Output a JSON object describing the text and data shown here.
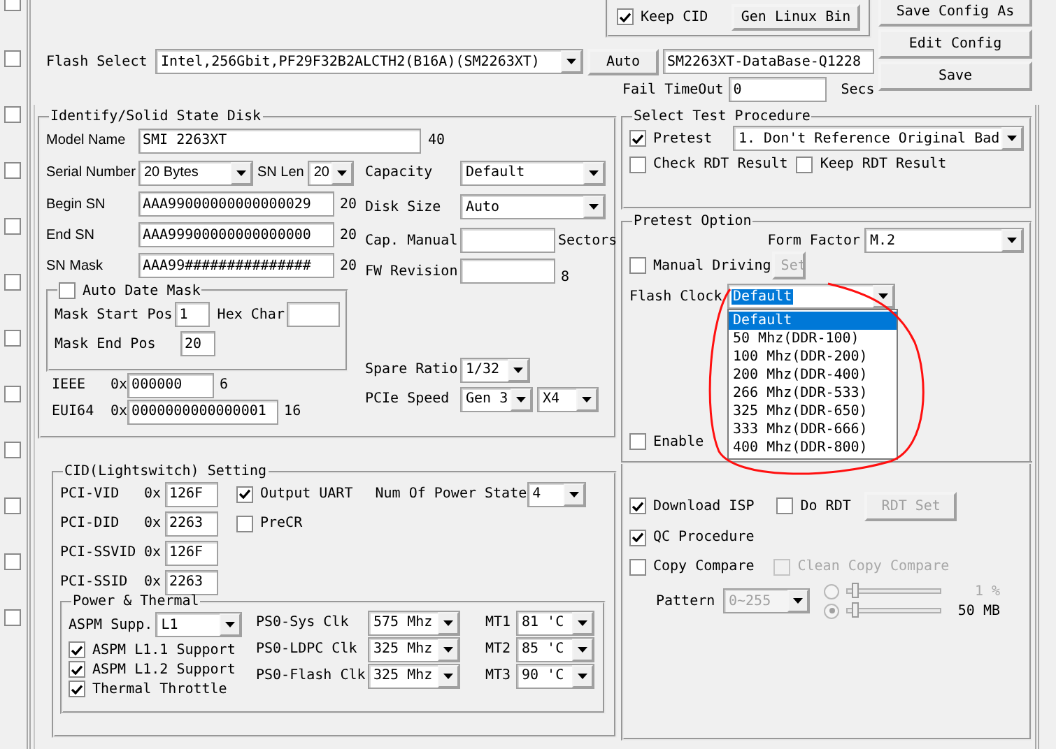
{
  "left_checkboxes": [
    {
      "checked": false
    },
    {
      "checked": false
    },
    {
      "checked": false
    },
    {
      "checked": false
    },
    {
      "checked": false
    },
    {
      "checked": false
    },
    {
      "checked": false
    },
    {
      "checked": false
    },
    {
      "checked": false
    },
    {
      "checked": false
    },
    {
      "checked": false
    },
    {
      "checked": false
    }
  ],
  "config_buttons": [
    "Save Config As",
    "Edit Config",
    "Save"
  ],
  "gen_group": {
    "keep_cid": {
      "label": "Keep CID",
      "checked": true
    },
    "button": "Gen Linux Bin"
  },
  "flash_select": {
    "label": "Flash Select",
    "value": "Intel,256Gbit,PF29F32B2ALCTH2(B16A)(SM2263XT)",
    "button": "Auto",
    "database": "SM2263XT-DataBase-Q1228"
  },
  "fail_timeout": {
    "label": "Fail TimeOut",
    "value": "0",
    "unit": "Secs"
  },
  "identify": {
    "title": "Identify/Solid State Disk",
    "model_name": {
      "label": "Model Name",
      "value": "SMI 2263XT",
      "length": "40"
    },
    "serial_number": {
      "label": "Serial Number",
      "value": "20 Bytes"
    },
    "sn_len": {
      "label": "SN Len",
      "value": "20"
    },
    "sn_fields": [
      {
        "label": "Begin SN",
        "value": "AAA99000000000000029",
        "length": "20"
      },
      {
        "label": "End SN",
        "value": "AAA99900000000000000",
        "length": "20"
      },
      {
        "label": "SN Mask",
        "value": "AAA99###############",
        "length": "20"
      }
    ],
    "capacity": {
      "label": "Capacity",
      "value": "Default"
    },
    "disk_size": {
      "label": "Disk Size",
      "value": "Auto"
    },
    "cap_manual": {
      "label": "Cap. Manual",
      "unit": "Sectors"
    },
    "fw_revision": {
      "label": "FW Revision",
      "length": "8"
    },
    "auto_date_mask": {
      "label": "Auto Date Mask",
      "checked": false,
      "mask_start": {
        "label": "Mask Start Pos",
        "value": "1"
      },
      "hex_char": {
        "label": "Hex Char"
      },
      "mask_end": {
        "label": "Mask End Pos",
        "value": "20"
      }
    },
    "ids": [
      {
        "label": "IEEE",
        "prefix": "0x",
        "value": "000000",
        "length": "6"
      },
      {
        "label": "EUI64",
        "prefix": "0x",
        "value": "0000000000000001",
        "length": "16"
      }
    ],
    "spare_ratio": {
      "label": "Spare Ratio",
      "value": "1/32"
    },
    "pcie_speed": {
      "label": "PCIe Speed",
      "gen": "Gen 3",
      "lanes": "X4"
    }
  },
  "cid": {
    "title": "CID(Lightswitch) Setting",
    "ids": [
      {
        "label": "PCI-VID",
        "prefix": "0x",
        "value": "126F"
      },
      {
        "label": "PCI-DID",
        "prefix": "0x",
        "value": "2263"
      },
      {
        "label": "PCI-SSVID",
        "prefix": "0x",
        "value": "126F"
      },
      {
        "label": "PCI-SSID",
        "prefix": "0x",
        "value": "2263"
      }
    ],
    "output_uart": {
      "label": "Output UART",
      "checked": true
    },
    "precr": {
      "label": "PreCR",
      "checked": false
    },
    "power_states": {
      "label": "Num Of Power State",
      "value": "4"
    },
    "power_thermal": {
      "title": "Power & Thermal",
      "aspm": {
        "label": "ASPM Supp.",
        "value": "L1"
      },
      "options": [
        {
          "label": "ASPM L1.1 Support",
          "checked": true
        },
        {
          "label": "ASPM L1.2 Support",
          "checked": true
        },
        {
          "label": "Thermal Throttle",
          "checked": true
        }
      ],
      "clocks": [
        {
          "label": "PS0-Sys Clk",
          "value": "575 Mhz"
        },
        {
          "label": "PS0-LDPC Clk",
          "value": "325 Mhz"
        },
        {
          "label": "PS0-Flash Clk",
          "value": "325 Mhz"
        }
      ],
      "temps": [
        {
          "label": "MT1",
          "value": "81 'C"
        },
        {
          "label": "MT2",
          "value": "85 'C"
        },
        {
          "label": "MT3",
          "value": "90 'C"
        }
      ]
    }
  },
  "test_procedure": {
    "title": "Select Test Procedure",
    "pretest": {
      "label": "Pretest",
      "checked": true
    },
    "procedure": "1. Don't Reference Original Bad",
    "check_rdt": {
      "label": "Check RDT Result",
      "checked": false
    },
    "keep_rdt": {
      "label": "Keep RDT Result",
      "checked": false
    }
  },
  "pretest_option": {
    "title": "Pretest Option",
    "form_factor": {
      "label": "Form Factor",
      "value": "M.2"
    },
    "manual_driving": {
      "label": "Manual Driving",
      "checked": false
    },
    "set_button": {
      "label": "Set",
      "disabled": true
    },
    "flash_clock": {
      "label": "Flash Clock",
      "value": "Default",
      "expanded": true,
      "options": [
        {
          "label": "Default",
          "selected": true
        },
        {
          "label": "50 Mhz(DDR-100)",
          "selected": false
        },
        {
          "label": "100 Mhz(DDR-200)",
          "selected": false
        },
        {
          "label": "200 Mhz(DDR-400)",
          "selected": false
        },
        {
          "label": "266 Mhz(DDR-533)",
          "selected": false
        },
        {
          "label": "325 Mhz(DDR-650)",
          "selected": false
        },
        {
          "label": "333 Mhz(DDR-666)",
          "selected": false
        },
        {
          "label": "400 Mhz(DDR-800)",
          "selected": false
        }
      ]
    },
    "enable": {
      "label": "Enable",
      "checked": false
    }
  },
  "qc": {
    "download_isp": {
      "label": "Download ISP",
      "checked": true
    },
    "do_rdt": {
      "label": "Do RDT",
      "checked": false
    },
    "rdt_set": {
      "label": "RDT Set",
      "disabled": true
    },
    "qc_procedure": {
      "label": "QC Procedure",
      "checked": true
    },
    "copy_compare": {
      "label": "Copy Compare",
      "checked": false
    },
    "clean_copy_compare": {
      "label": "Clean Copy Compare",
      "checked": false,
      "disabled": true
    },
    "pattern": {
      "label": "Pattern",
      "value": "0~255",
      "disabled": true
    },
    "ranges": [
      {
        "selected": false,
        "level": 0.05,
        "reading": "1 %",
        "disabled": true
      },
      {
        "selected": true,
        "level": 0.05,
        "reading": "50 MB",
        "disabled": false
      }
    ]
  }
}
